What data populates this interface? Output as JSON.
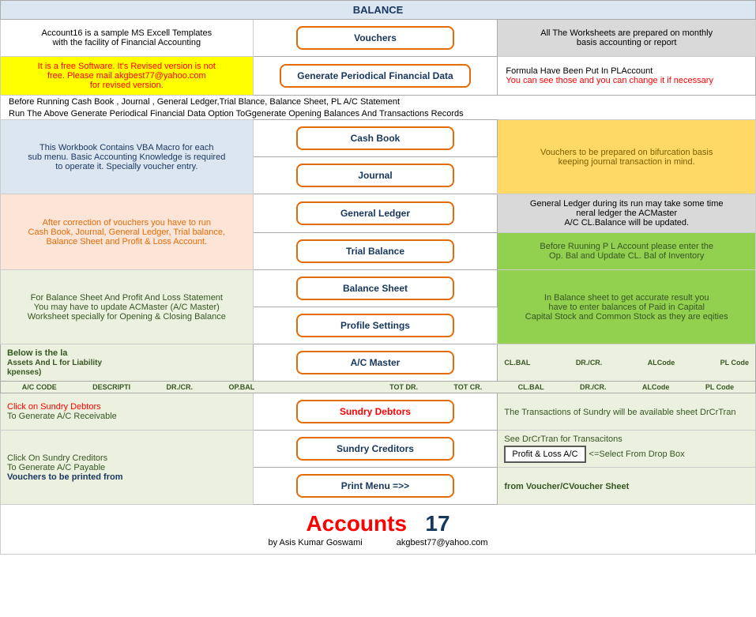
{
  "header": {
    "balance_label": "BALANCE"
  },
  "row1": {
    "left": "Account16 is a sample MS Excell Templates\nwith the facility of Financial Accounting",
    "btn": "Vouchers",
    "right": "All The Worksheets are prepared on monthly\nbasis accounting or report"
  },
  "row2": {
    "left": "It is a free Software. It's Revised version is not\nfree.  Please mail akgbest77@yahoo.com\nfor revised version.",
    "btn": "Generate Periodical Financial Data",
    "right_line1": "Formula Have Been Put In PLAccount",
    "right_line2": "You can see those and you can change it if necessary"
  },
  "info1": "Before Running Cash Book , Journal , General Ledger,Trial Blance, Balance Sheet, PL A/C Statement",
  "info2": "Run The Above Generate Periodical Financial Data Option ToGgenerate Opening Balances And Transactions Records",
  "row3": {
    "left": "This Workbook Contains VBA Macro for each\nsub menu. Basic Accounting Knowledge is required\nto operate it. Specially voucher entry.",
    "btn": "Cash Book",
    "right": "Vouchers to be prepared on bifurcation basis\nkeeping journal transaction in mind."
  },
  "row4": {
    "btn": "Journal",
    "right_line1": "General Ledger during its run may take some time",
    "right_line2": "neral ledger the ACMaster",
    "right_line3": "A/C CL.Balance will be updated."
  },
  "row5": {
    "left": "After correction of vouchers you have to run\nCash Book, Journal, General Ledger, Trial balance,\nBalance Sheet and Profit & Loss Account.",
    "btn": "General Ledger",
    "right": ""
  },
  "row6": {
    "btn": "Trial Balance",
    "right": "Before Ruuning P L Account please enter the\nOp. Bal and Update CL. Bal of Inventory"
  },
  "row7": {
    "left": "For Balance Sheet And Profit And Loss Statement\nYou may have to update ACMaster (A/C Master)\nWorksheet specially for Opening & Closing Balance",
    "btn": "Balance Sheet",
    "right": "In Balance sheet to get accurate result you\nhave to enter balances of Paid in Capital\nCapital Stock and Common Stock as they are eqities"
  },
  "row8": {
    "btn": "Profile Settings"
  },
  "acmaster": {
    "header_left": "Below is the la",
    "header_right": "Assets And L for Liability\nkpenses)",
    "btn": "A/C Master",
    "cols": {
      "ac_code": "A/C CODE",
      "descripti": "DESCRIPTI",
      "dr_cr": "DR./CR.",
      "op_bal": "OP.BAL",
      "tot_dr": "TOT DR.",
      "tot_cr": "TOT CR.",
      "cl_bal": "CL.BAL",
      "dr_cr2": "DR./CR.",
      "alcode": "ALCode",
      "pl_code": "PL Code"
    }
  },
  "sundry_debtors": {
    "left_line1": "Click on Sundry Debtors",
    "left_line2": "To Generate A/C Receivable",
    "btn": "Sundry Debtors",
    "right": "The Transactions of Sundry will\nbe available sheet DrCrTran"
  },
  "sundry_creditors": {
    "left_line1": "Click On Sundry Creditors",
    "left_line2": "To Generate A/C Payable",
    "left_line3": "Vouchers to be printed from",
    "btn": "Sundry Creditors",
    "right_line1": "See DrCrTran for Transacitons",
    "profit_loss": "Profit & Loss A/C",
    "select_text": "<=Select From Drop Box",
    "right_line3": "from Voucher/CVoucher Sheet"
  },
  "print_menu": {
    "btn": "Print Menu =>>"
  },
  "footer": {
    "accounts": "Accounts",
    "number": "17",
    "by_text": "by Asis Kumar Goswami",
    "email": "akgbest77@yahoo.com"
  }
}
